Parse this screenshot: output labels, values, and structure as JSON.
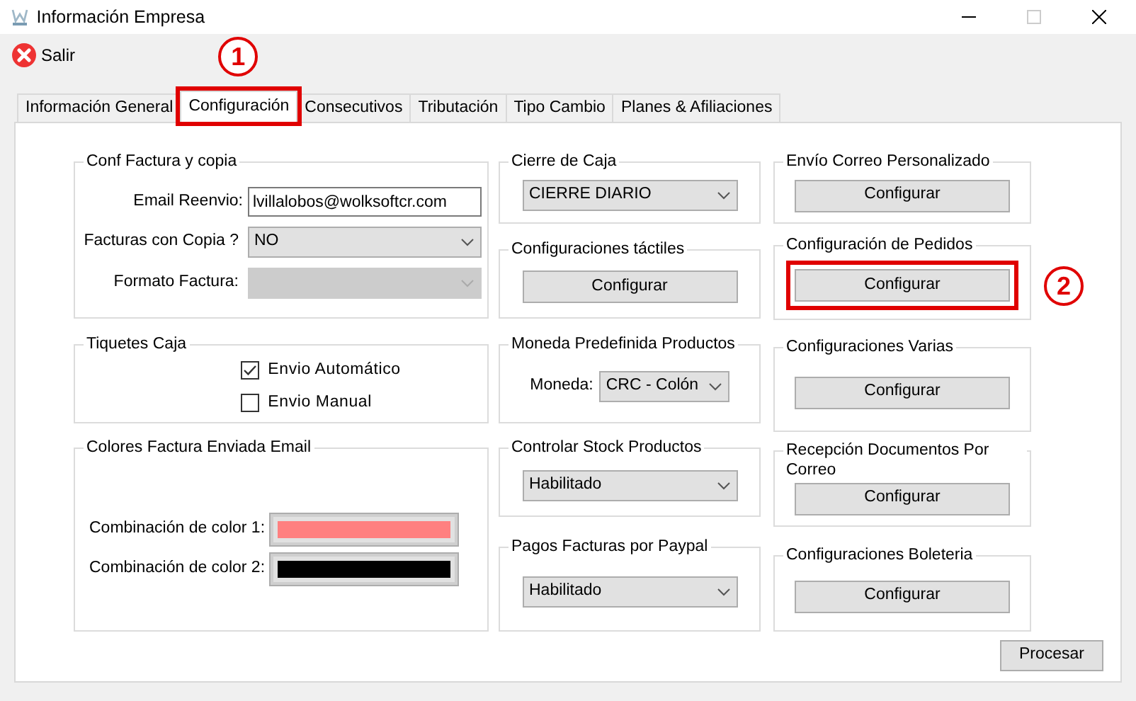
{
  "window": {
    "title": "Información Empresa",
    "controls": [
      {
        "kind": "minimize",
        "disabled": false
      },
      {
        "kind": "maximize",
        "disabled": true
      },
      {
        "kind": "close",
        "disabled": false
      }
    ]
  },
  "toolbar": [
    {
      "label": "Salir"
    }
  ],
  "tabs": [
    {
      "label": "Información General",
      "selected": false
    },
    {
      "label": "Configuración",
      "selected": true,
      "callout": "1"
    },
    {
      "label": "Consecutivos",
      "selected": false
    },
    {
      "label": "Tributación",
      "selected": false
    },
    {
      "label": "Tipo Cambio",
      "selected": false
    },
    {
      "label": "Planes & Afiliaciones",
      "selected": false
    }
  ],
  "columns": [
    [
      {
        "title": "Conf Factura y copia",
        "items": [
          {
            "kind": "text",
            "label": "Email Reenvio:",
            "value": "lvillalobos@wolksoftcr.com"
          },
          {
            "kind": "select",
            "label": "Facturas con Copia ?",
            "value": "NO",
            "disabled": false
          },
          {
            "kind": "select",
            "label": "Formato Factura:",
            "disabled": true
          }
        ]
      },
      {
        "title": "Tiquetes Caja",
        "items": [
          {
            "kind": "checkbox",
            "label": "Envio Automático",
            "checked": true
          },
          {
            "kind": "checkbox",
            "label": "Envio Manual",
            "checked": false
          }
        ]
      },
      {
        "title": "Colores Factura Enviada Email",
        "items": [
          {
            "kind": "color",
            "label": "Combinación de color 1:",
            "color": "#ff8080"
          },
          {
            "kind": "color",
            "label": "Combinación de color 2:",
            "color": "#000000"
          }
        ]
      }
    ],
    [
      {
        "title": "Cierre de Caja",
        "items": [
          {
            "kind": "select",
            "value": "CIERRE DIARIO",
            "disabled": false
          }
        ]
      },
      {
        "title": "Configuraciones táctiles",
        "items": [
          {
            "kind": "button",
            "label": "Configurar"
          }
        ]
      },
      {
        "title": "Moneda Predefinida Productos",
        "items": [
          {
            "kind": "select",
            "label": "Moneda:",
            "value": "CRC - Colón",
            "disabled": false
          }
        ]
      },
      {
        "title": "Controlar Stock Productos",
        "items": [
          {
            "kind": "select",
            "value": "Habilitado",
            "disabled": false
          }
        ]
      },
      {
        "title": "Pagos Facturas por Paypal",
        "items": [
          {
            "kind": "select",
            "value": "Habilitado",
            "disabled": false
          }
        ]
      }
    ],
    [
      {
        "title": "Envío Correo Personalizado",
        "items": [
          {
            "kind": "button",
            "label": "Configurar"
          }
        ]
      },
      {
        "title": "Configuración de Pedidos",
        "items": [
          {
            "kind": "button",
            "label": "Configurar",
            "callout": "2"
          }
        ]
      },
      {
        "title": "Configuraciones Varias",
        "items": [
          {
            "kind": "button",
            "label": "Configurar"
          }
        ]
      },
      {
        "title": "Recepción Documentos Por Correo",
        "items": [
          {
            "kind": "button",
            "label": "Configurar"
          }
        ]
      },
      {
        "title": "Configuraciones Boleteria",
        "items": [
          {
            "kind": "button",
            "label": "Configurar"
          }
        ]
      }
    ]
  ],
  "footer_button": "Procesar"
}
